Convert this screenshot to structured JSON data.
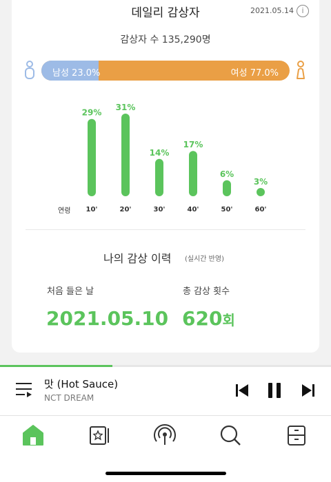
{
  "daily": {
    "title": "데일리 감상자",
    "date": "2021.05.14",
    "info_glyph": "i",
    "listeners_text": "감상자 수 135,290명"
  },
  "gender": {
    "male_label": "남성 23.0%",
    "female_label": "여성 77.0%",
    "male_fraction": 0.23,
    "male_color": "#9dbbe6",
    "female_color": "#ea9f45"
  },
  "chart_data": {
    "type": "bar",
    "xlabel": "연령",
    "categories": [
      "10'",
      "20'",
      "30'",
      "40'",
      "50'",
      "60'"
    ],
    "values": [
      29,
      31,
      14,
      17,
      6,
      3
    ],
    "value_labels": [
      "29%",
      "31%",
      "14%",
      "17%",
      "6%",
      "3%"
    ],
    "color": "#5bc45c",
    "ylim": [
      0,
      31
    ]
  },
  "history": {
    "title": "나의 감상 이력",
    "subtitle": "(실시간 반영)",
    "first_label": "처음 들은 날",
    "first_value": "2021.05.10",
    "count_label": "총 감상 횟수",
    "count_number": "620",
    "count_unit": "회"
  },
  "player": {
    "progress": 0.34,
    "title": "맛 (Hot Sauce)",
    "artist": "NCT DREAM",
    "icons": [
      "playlist-icon",
      "previous-icon",
      "pause-icon",
      "next-icon"
    ]
  },
  "tabs": [
    {
      "name": "home-icon",
      "active": true
    },
    {
      "name": "library-icon",
      "active": false
    },
    {
      "name": "podcast-icon",
      "active": false
    },
    {
      "name": "search-icon",
      "active": false
    },
    {
      "name": "storage-icon",
      "active": false
    }
  ],
  "accent_color": "#5bc45c"
}
